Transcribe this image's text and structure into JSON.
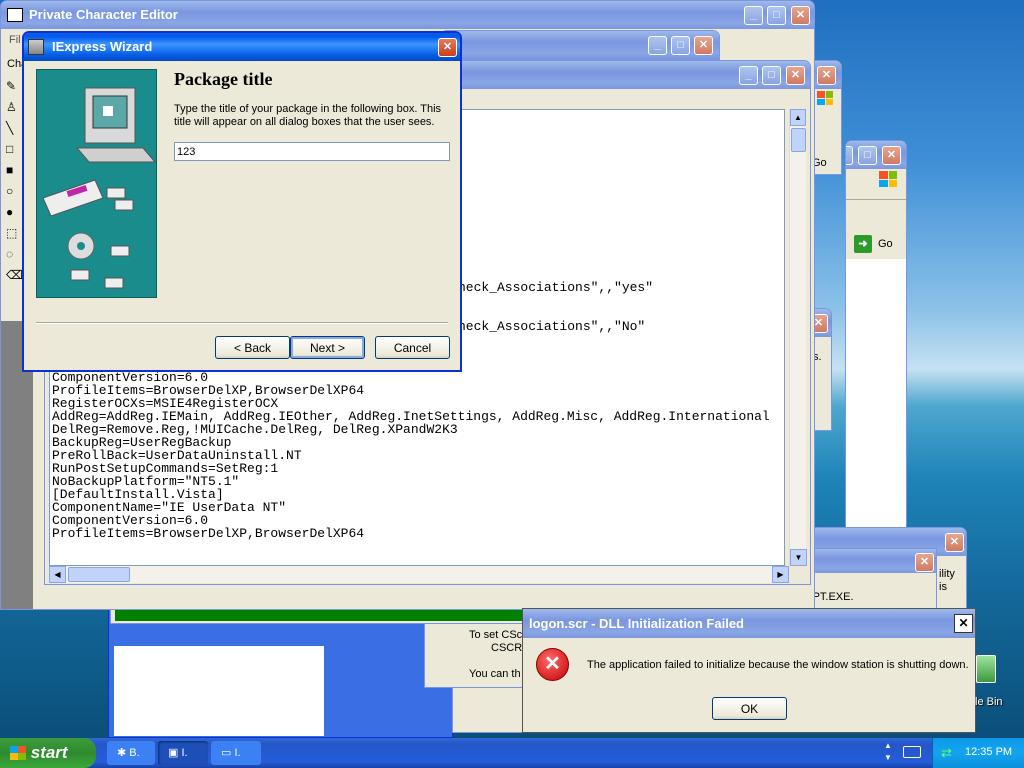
{
  "private_char_editor": {
    "title": "Private Character Editor",
    "menu_stub": "Fil",
    "label_stub": "Cha"
  },
  "code_window": {
    "lines": [
      "ComponentVersion=6.0",
      "ProfileItems=BrowserDelXP,BrowserDelXP64",
      "RegisterOCXs=MSIE4RegisterOCX",
      "AddReg=AddReg.IEMain, AddReg.IEOther, AddReg.InetSettings, AddReg.Misc, AddReg.International",
      "DelReg=Remove.Reg,!MUICache.DelReg, DelReg.XPandW2K3",
      "BackupReg=UserRegBackup",
      "PreRollBack=UserDataUninstall.NT",
      "RunPostSetupCommands=SetReg:1",
      "NoBackupPlatform=\"NT5.1\"",
      "",
      "[DefaultInstall.Vista]",
      "ComponentName=\"IE UserData NT\"",
      "ComponentVersion=6.0",
      "ProfileItems=BrowserDelXP,BrowserDelXP64"
    ],
    "frag1": "heck_Associations\",,\"yes\"",
    "frag2": "heck_Associations\",,\"No\""
  },
  "browser_window": {
    "go_label": "Go",
    "frag_go": "Go"
  },
  "side_window": {
    "frag": "s."
  },
  "back_window": {
    "frag1": "ility",
    "frag2": "is"
  },
  "cscript_window": {
    "text1": "using CSCRIPT.EXE.",
    "text2": "To set CSc",
    "text3": "CSCRI",
    "text4": "You can th"
  },
  "iexpress": {
    "title": "IExpress Wizard",
    "heading": "Package title",
    "description": "Type the title of your package in the following  box.  This title will appear on all dialog boxes that the user sees.",
    "input_value": "123",
    "back_label": "< Back",
    "next_label": "Next >",
    "cancel_label": "Cancel"
  },
  "error_dialog": {
    "title": "logon.scr - DLL Initialization Failed",
    "message": "The application failed to initialize because the window station is shutting down.",
    "ok_label": "OK"
  },
  "desktop": {
    "recycle_label": "le Bin"
  },
  "taskbar": {
    "start_label": "start",
    "items": [
      {
        "label": "B."
      },
      {
        "label": "I."
      },
      {
        "label": "I."
      }
    ],
    "clock": "12:35 PM"
  },
  "colors": {
    "xp_blue": "#0054e3",
    "error_red": "#d01818",
    "green_bar": "#008000"
  }
}
